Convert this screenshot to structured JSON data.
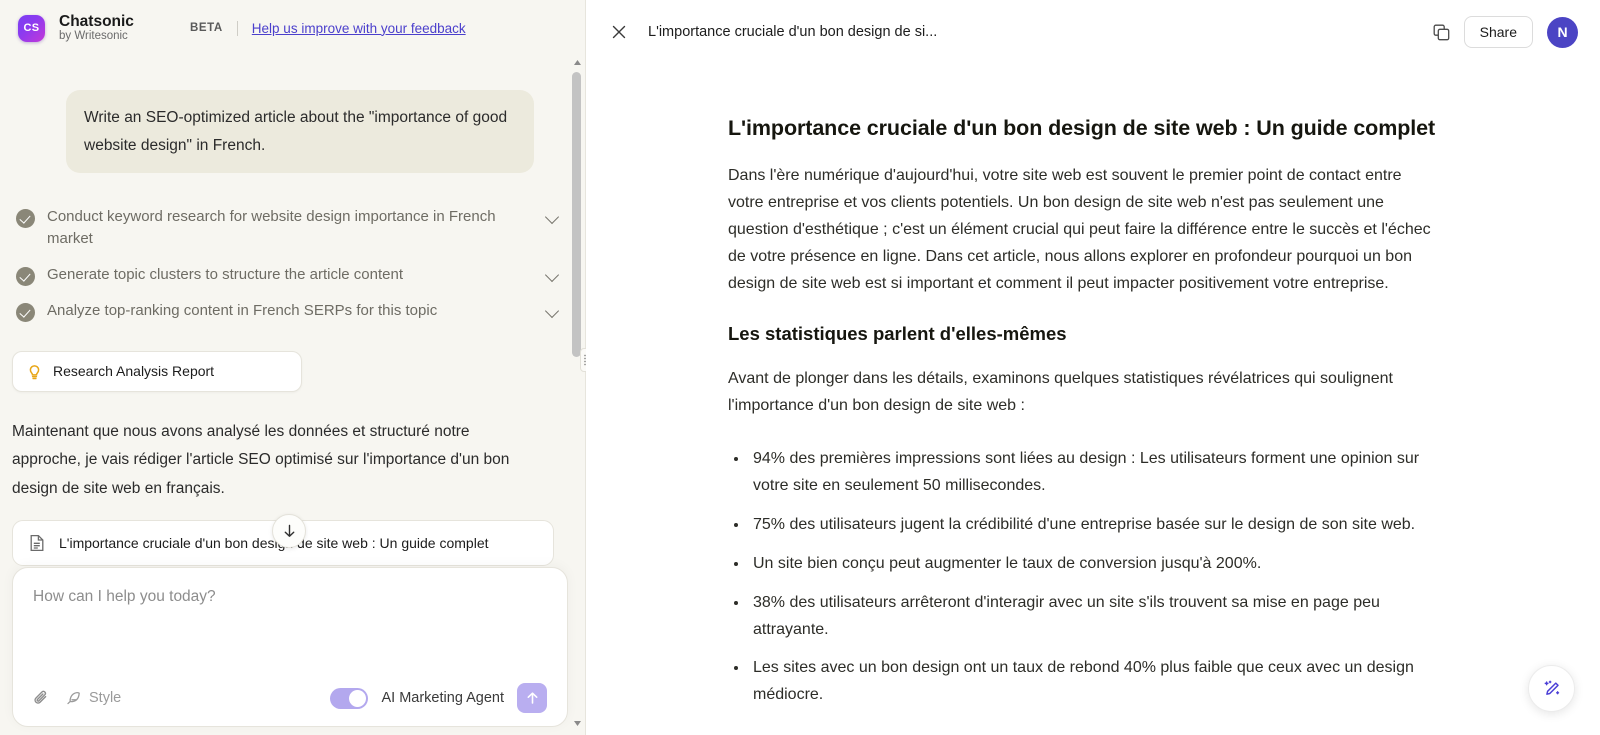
{
  "sidebar": {
    "brand": {
      "logo_text": "CS",
      "name": "Chatsonic",
      "subtitle": "by Writesonic"
    },
    "beta_tag": "BETA",
    "feedback_link": "Help us improve with your feedback",
    "user_message": "Write an SEO-optimized article about the \"importance of good website design\" in French.",
    "tasks": [
      {
        "label": "Conduct keyword research for website design importance in French market"
      },
      {
        "label": "Generate topic clusters to structure the article content"
      },
      {
        "label": "Analyze top-ranking content in French SERPs for this topic"
      }
    ],
    "report_chip": "Research Analysis Report",
    "assistant_message": "Maintenant que nous avons analysé les données et structuré notre approche, je vais rédiger l'article SEO optimisé sur l'importance d'un bon design de site web en français.",
    "doc_card": "L'importance cruciale d'un bon design de site web : Un guide complet"
  },
  "composer": {
    "placeholder": "How can I help you today?",
    "style_label": "Style",
    "agent_label": "AI Marketing Agent",
    "agent_enabled": "on"
  },
  "doc_header": {
    "title": "L'importance cruciale d'un bon design de si...",
    "share_label": "Share",
    "avatar_initial": "N"
  },
  "article": {
    "h1": "L'importance cruciale d'un bon design de site web : Un guide complet",
    "intro": "Dans l'ère numérique d'aujourd'hui, votre site web est souvent le premier point de contact entre votre entreprise et vos clients potentiels. Un bon design de site web n'est pas seulement une question d'esthétique ; c'est un élément crucial qui peut faire la différence entre le succès et l'échec de votre présence en ligne. Dans cet article, nous allons explorer en profondeur pourquoi un bon design de site web est si important et comment il peut impacter positivement votre entreprise.",
    "h2": "Les statistiques parlent d'elles-mêmes",
    "lead": "Avant de plonger dans les détails, examinons quelques statistiques révélatrices qui soulignent l'importance d'un bon design de site web :",
    "bullets": [
      "94% des premières impressions sont liées au design : Les utilisateurs forment une opinion sur votre site en seulement 50 millisecondes.",
      "75% des utilisateurs jugent la crédibilité d'une entreprise basée sur le design de son site web.",
      "Un site bien conçu peut augmenter le taux de conversion jusqu'à 200%.",
      "38% des utilisateurs arrêteront d'interagir avec un site s'ils trouvent sa mise en page peu attrayante.",
      "Les sites avec un bon design ont un taux de rebond 40% plus faible que ceux avec un design médiocre."
    ]
  },
  "colors": {
    "brand_purple": "#7b3ff2",
    "brand_magenta": "#c438d8",
    "link_indigo": "#4b3fcc",
    "avatar_indigo": "#4b44c4",
    "toggle_lavender": "#b3a8ee",
    "bulb_amber": "#e8a617",
    "chat_bg": "#f7f6f1",
    "bubble_bg": "#eceadd"
  }
}
